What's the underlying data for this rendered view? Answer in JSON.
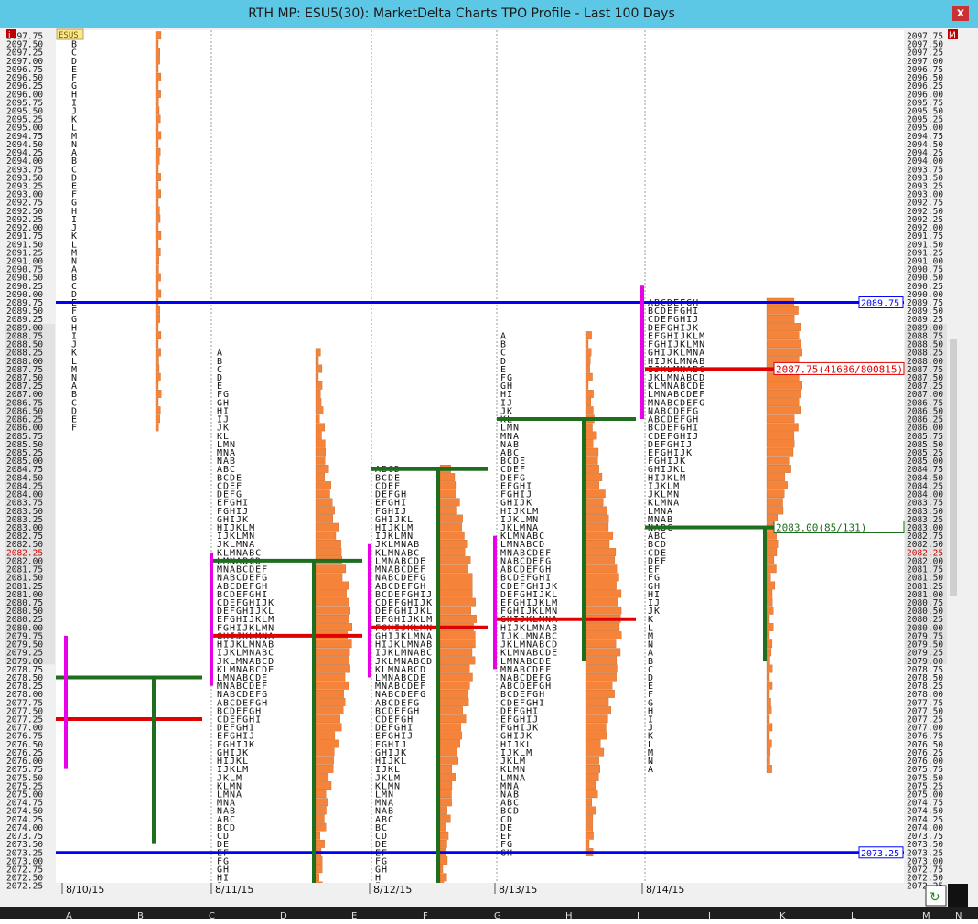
{
  "window": {
    "title": "RTH MP: ESU5(30): MarketDelta Charts TPO Profile - Last 100 Days",
    "close_label": "x"
  },
  "symbol_badge": "ESUS",
  "corner_left": "i",
  "corner_right": "M",
  "bottom_letters": [
    "A",
    "B",
    "C",
    "D",
    "E",
    "F",
    "G",
    "H",
    "I",
    "J",
    "K",
    "L",
    "M",
    "N"
  ],
  "colors": {
    "profile_fill": "#f5843a",
    "value_area_line": "#1e6e1e",
    "poc_line": "#e00000",
    "blue_line": "#0000ff",
    "magenta_range": "#e800e8",
    "axis_bg": "#e6e6e6"
  },
  "chart_data": {
    "type": "tpo_profile",
    "instrument": "ESU5(30)",
    "y_range": [
      2072.25,
      2097.75
    ],
    "tick_size": 0.25,
    "x_dates": [
      "8/10/15",
      "8/11/15",
      "8/12/15",
      "8/13/15",
      "8/14/15"
    ],
    "horizontal_lines": [
      {
        "price": 2089.75,
        "color": "blue",
        "label": "2089.75"
      },
      {
        "price": 2073.25,
        "color": "blue",
        "label": "2073.25"
      }
    ],
    "price_labels": [
      {
        "price": 2087.75,
        "text": "2087.75(41686/800815)",
        "color": "red"
      },
      {
        "price": 2083.0,
        "text": "2083.00(85/131)",
        "color": "green"
      }
    ],
    "highlighted_axis_price": "2082.25",
    "sessions": [
      {
        "date": "8/10/15",
        "high": 2097.75,
        "low": 2086.0,
        "poc": 2077.25,
        "vah": 2078.5,
        "val": 2073.5
      },
      {
        "date": "8/11/15",
        "high": 2088.25,
        "low": 2072.25,
        "poc": 2079.75,
        "vah": 2082.0,
        "val": 2072.25
      },
      {
        "date": "8/12/15",
        "high": 2084.75,
        "low": 2072.25,
        "poc": 2080.0,
        "vah": 2084.75,
        "val": 2072.25
      },
      {
        "date": "8/13/15",
        "high": 2088.75,
        "low": 2073.25,
        "poc": 2080.25,
        "vah": 2086.25,
        "val": 2079.0
      },
      {
        "date": "8/14/15",
        "high": 2089.75,
        "low": 2075.75,
        "poc": 2087.75,
        "vah": 2083.0,
        "val": 2079.0
      }
    ]
  }
}
